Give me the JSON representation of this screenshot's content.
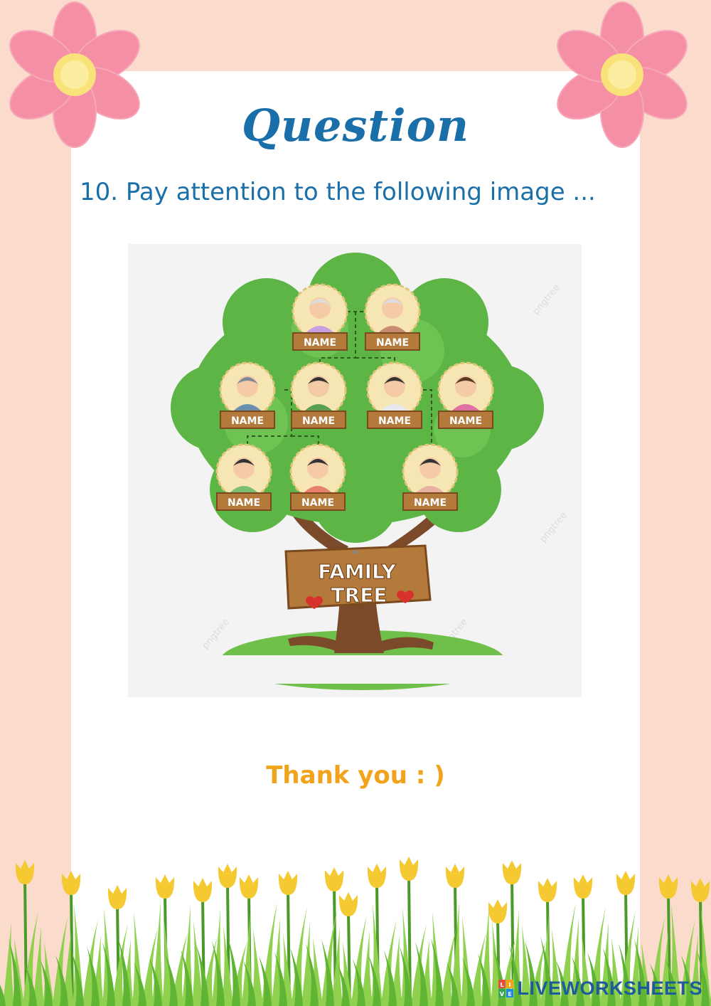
{
  "header": {
    "title": "Question",
    "prompt": "10. Pay attention to the following image ..."
  },
  "figure": {
    "node_label": "NAME",
    "sign_line1": "FAMILY",
    "sign_line2": "TREE",
    "watermark": "pngtree"
  },
  "footer": {
    "thanks": "Thank you : )",
    "brand": "LIVEWORKSHEETS",
    "brand_logo_letters": "LIVE"
  },
  "colors": {
    "background": "#fbdccc",
    "title": "#1a6fa8",
    "thanks": "#f1a31c",
    "brand": "#1e5b9a"
  }
}
